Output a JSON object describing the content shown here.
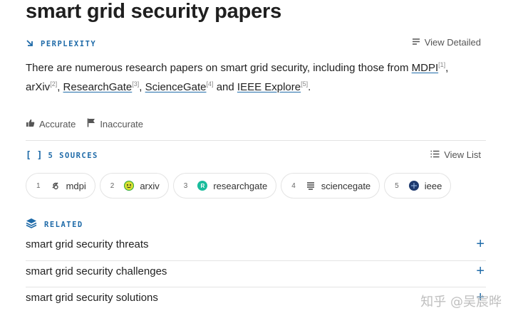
{
  "title": "smart grid security papers",
  "source_header": {
    "icon": "arrow-down-right-icon",
    "label": "PERPLEXITY"
  },
  "view_detailed": "View Detailed",
  "answer": {
    "part1": "There are numerous research papers on smart grid security, including those from ",
    "links": [
      {
        "text": "MDPI",
        "ref": "[1]"
      },
      {
        "text": "arXiv",
        "ref": "[2]"
      },
      {
        "text": "ResearchGate",
        "ref": "[3]"
      },
      {
        "text": "ScienceGate",
        "ref": "[4]"
      },
      {
        "text": "IEEE Explore",
        "ref": "[5]"
      }
    ],
    "sep1": ", ",
    "sep_and": " and ",
    "end": "."
  },
  "feedback": {
    "accurate": "Accurate",
    "inaccurate": "Inaccurate"
  },
  "sources": {
    "label": "5 SOURCES",
    "view_list": "View List",
    "items": [
      {
        "num": "1",
        "name": "mdpi",
        "color": "#555555"
      },
      {
        "num": "2",
        "name": "arxiv",
        "color": "#2aa84a"
      },
      {
        "num": "3",
        "name": "researchgate",
        "color": "#1abc9c"
      },
      {
        "num": "4",
        "name": "sciencegate",
        "color": "#444444"
      },
      {
        "num": "5",
        "name": "ieee",
        "color": "#1e3a6e"
      }
    ]
  },
  "related": {
    "label": "RELATED",
    "items": [
      "smart grid security threats",
      "smart grid security challenges",
      "smart grid security solutions"
    ]
  },
  "watermark": "知乎 @吴宸晔",
  "colors": {
    "accent": "#1e6aa8",
    "text": "#222222",
    "muted": "#555555",
    "divider": "#e3e3e3"
  }
}
